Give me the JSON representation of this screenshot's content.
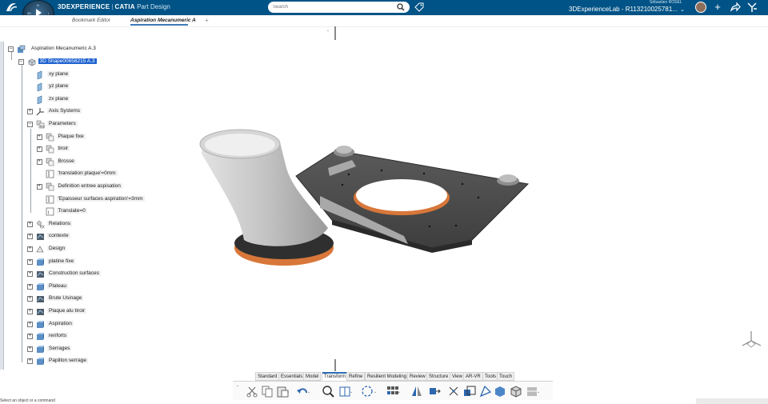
{
  "header": {
    "brand": "3DEXPERIENCE",
    "app_brand": "CATIA",
    "app_name": "Part Design",
    "compass_version": "V.R",
    "search_placeholder": "Search",
    "user_name": "Sébastien ROSEL",
    "platform": "3DExperienceLab - R113210025781...",
    "accent_color": "#005386"
  },
  "tabs": [
    {
      "label": "Bookmark Editor",
      "active": false
    },
    {
      "label": "Aspiration Mecanumeric A",
      "active": true
    }
  ],
  "tree": {
    "root": "Aspiration Mecanumeric A.3",
    "items": [
      {
        "label": "3D Shape00658215 A.3",
        "icon": "part-icon",
        "selected": true
      },
      {
        "label": "xy plane",
        "icon": "plane-icon"
      },
      {
        "label": "yz plane",
        "icon": "plane-icon"
      },
      {
        "label": "zx plane",
        "icon": "plane-icon"
      },
      {
        "label": "Axis Systems",
        "icon": "axis-icon"
      },
      {
        "label": "Parameters",
        "icon": "parameters-icon"
      },
      {
        "label": "Plaque fixe",
        "icon": "parameter-set-icon"
      },
      {
        "label": "tiroir",
        "icon": "parameter-set-icon"
      },
      {
        "label": "Brosse",
        "icon": "parameter-set-icon"
      },
      {
        "label": "'translation plaque'=0mm",
        "icon": "length-param-icon"
      },
      {
        "label": "Definition entree aspisation",
        "icon": "parameter-set-icon"
      },
      {
        "label": "'Epaisseur surfaces aspiration'=3mm",
        "icon": "length-param-icon"
      },
      {
        "label": "Translate=0",
        "icon": "integer-param-icon"
      },
      {
        "label": "Relations",
        "icon": "relations-icon"
      },
      {
        "label": "contexte",
        "icon": "geoset-icon"
      },
      {
        "label": "Design",
        "icon": "design-icon"
      },
      {
        "label": "platine fixe",
        "icon": "body-icon"
      },
      {
        "label": "Construction surfaces",
        "icon": "geoset-icon"
      },
      {
        "label": "Plateau",
        "icon": "body-icon"
      },
      {
        "label": "Brute Usinage",
        "icon": "geoset-icon"
      },
      {
        "label": "Plaque alu tiroir",
        "icon": "geoset-icon"
      },
      {
        "label": "Aspiration",
        "icon": "body-icon"
      },
      {
        "label": "renforts",
        "icon": "body-icon"
      },
      {
        "label": "Serrages",
        "icon": "body-icon"
      },
      {
        "label": "Papillon serrage",
        "icon": "body-icon"
      }
    ]
  },
  "action_bar": {
    "tabs": [
      "Standard",
      "Essentials",
      "Model",
      "Transform",
      "Refine",
      "Resilient Modeling",
      "Review",
      "Structure",
      "View",
      "AR-VR",
      "Tools",
      "Touch"
    ],
    "active_tab": "Transform",
    "tools": [
      "cut-icon",
      "copy-icon",
      "paste-icon",
      "undo-icon",
      "zoom-icon",
      "book-icon",
      "rotate-icon",
      "pattern-icon",
      "mirror-icon",
      "translate-icon",
      "axis-transform-icon",
      "scale-icon",
      "affinity-icon",
      "extract-icon",
      "join-icon",
      "explode-icon"
    ]
  },
  "status": {
    "message": "Select an object or a command"
  },
  "colors": {
    "part_gray": "#b5b5b5",
    "plate_dark": "#4a4a4a",
    "seal_orange": "#d8773a"
  }
}
